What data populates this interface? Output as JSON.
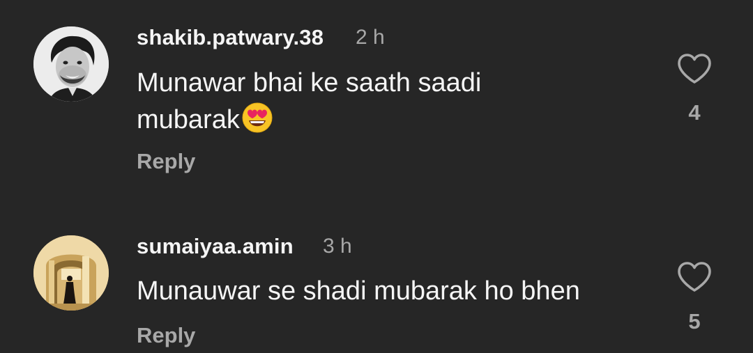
{
  "comments": [
    {
      "username": "shakib.patwary.38",
      "time": "2 h",
      "text": "Munawar bhai ke saath saadi mubarak",
      "emoji": "smiling-face-with-heart-eyes",
      "reply_label": "Reply",
      "likes": "4"
    },
    {
      "username": "sumaiyaa.amin",
      "time": "3 h",
      "text": "Munauwar se shadi mubarak ho bhen",
      "reply_label": "Reply",
      "likes": "5"
    }
  ],
  "colors": {
    "background": "#262626",
    "primary_text": "#f5f5f5",
    "secondary_text": "#a8a8a8"
  }
}
